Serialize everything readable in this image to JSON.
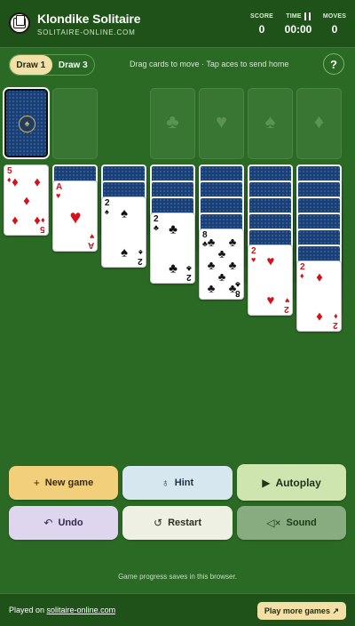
{
  "header": {
    "title": "Klondike Solitaire",
    "site": "SOLITAIRE-ONLINE.COM",
    "stats": {
      "score": {
        "label": "SCORE",
        "value": "0"
      },
      "time": {
        "label": "TIME",
        "value": "00:00"
      },
      "moves": {
        "label": "MOVES",
        "value": "0"
      }
    }
  },
  "toolbar": {
    "draw1": "Draw 1",
    "draw3": "Draw 3",
    "instructions": "Drag cards to move · Tap aces to send home",
    "help": "?"
  },
  "foundations": [
    "♣",
    "♥",
    "♠",
    "♦"
  ],
  "waste_card": {
    "rank": "5",
    "suit": "♦",
    "color": "red"
  },
  "tableau": [
    {
      "hidden": 1,
      "top": {
        "rank": "A",
        "suit": "♥",
        "color": "red"
      }
    },
    {
      "hidden": 2,
      "top": {
        "rank": "2",
        "suit": "♠",
        "color": "black"
      }
    },
    {
      "hidden": 3,
      "top": {
        "rank": "2",
        "suit": "♣",
        "color": "black"
      }
    },
    {
      "hidden": 4,
      "top": {
        "rank": "8",
        "suit": "♣",
        "color": "black"
      }
    },
    {
      "hidden": 5,
      "top": {
        "rank": "2",
        "suit": "♥",
        "color": "red"
      }
    },
    {
      "hidden": 6,
      "top": {
        "rank": "2",
        "suit": "♦",
        "color": "red"
      }
    }
  ],
  "buttons": {
    "new_game": "New game",
    "hint": "Hint",
    "autoplay": "Autoplay",
    "undo": "Undo",
    "restart": "Restart",
    "sound": "Sound"
  },
  "footer": {
    "note": "Game progress saves in this browser.",
    "played_on": "Played on",
    "link": "solitaire-online.com",
    "more": "Play more games ↗"
  },
  "colors": {
    "felt": "#2a6a24",
    "header": "#1f5219",
    "red_suit": "#d3121b",
    "new_game_bg": "#f2cf7a",
    "hint_bg": "#d7e7f0",
    "autoplay_bg": "#cfe5b0",
    "undo_bg": "#ddd6ee",
    "restart_bg": "#eef0e4",
    "sound_bg": "#88ac7f"
  }
}
